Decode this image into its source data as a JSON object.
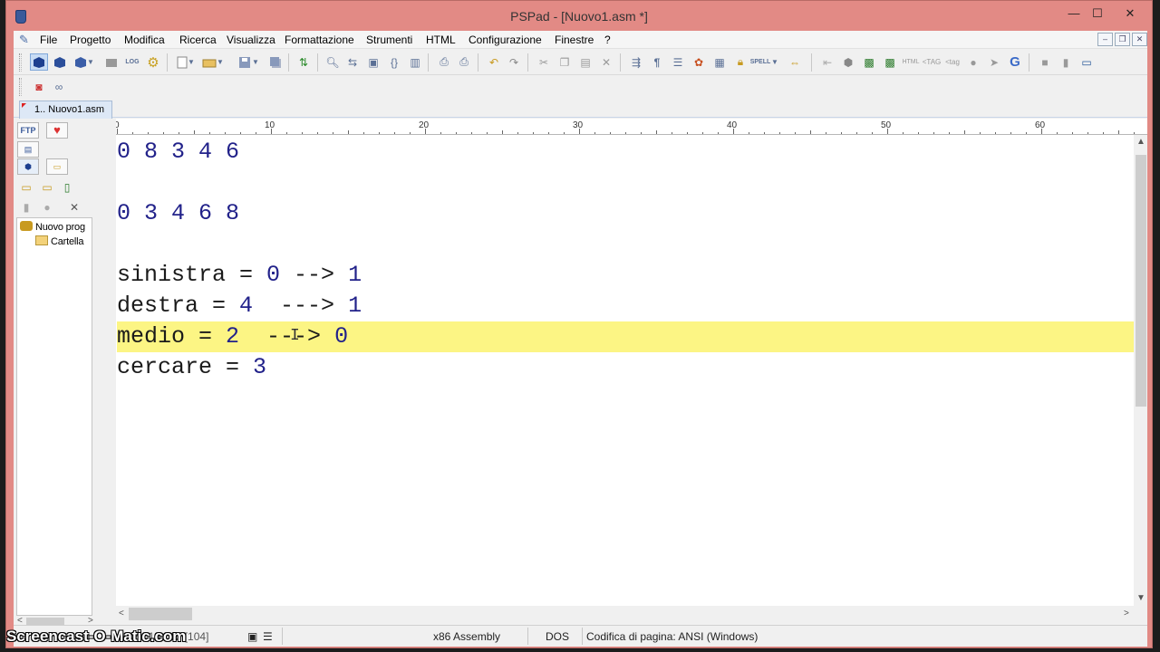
{
  "window": {
    "title": "PSPad - [Nuovo1.asm *]",
    "controls": {
      "minimize": "—",
      "maximize": "☐",
      "close": "✕"
    }
  },
  "menu": {
    "items": [
      "File",
      "Progetto",
      "Modifica",
      "Ricerca",
      "Visualizza",
      "Formattazione",
      "Strumenti",
      "HTML",
      "Configurazione",
      "Finestre",
      "?"
    ]
  },
  "tabs": [
    "1.. Nuovo1.asm"
  ],
  "side_panel": {
    "tab_ftp": "FTP",
    "tree": [
      {
        "label": "Nuovo prog"
      },
      {
        "label": "Cartella"
      }
    ]
  },
  "ruler": {
    "labels": [
      "0",
      "10",
      "20",
      "30",
      "40",
      "50",
      "60"
    ]
  },
  "editor": {
    "lines": [
      {
        "text": "0 8 3 4 6",
        "kind": "numbers"
      },
      {
        "text": "",
        "kind": "blank"
      },
      {
        "text": "0 3 4 6 8",
        "kind": "numbers"
      },
      {
        "text": "",
        "kind": "blank"
      },
      {
        "prefix": "sinistra = ",
        "value": "0",
        "arrow": " --> ",
        "result": "1",
        "kind": "assign"
      },
      {
        "prefix": "destra = ",
        "value": "4",
        "arrow": "  ---> ",
        "result": "1",
        "kind": "assign"
      },
      {
        "prefix": "medio = ",
        "value": "2",
        "arrow": "  ---> ",
        "result": "0",
        "kind": "assign",
        "current": true
      },
      {
        "prefix": "cercare = ",
        "value": "3",
        "arrow": "",
        "result": "",
        "kind": "assign"
      }
    ],
    "highlight_color": "#fcf584",
    "number_color": "#22228a"
  },
  "status": {
    "position": "7 : 18 / 12 [104]",
    "syntax": "x86 Assembly",
    "line_end": "DOS",
    "encoding": "Codifica di pagina: ANSI (Windows)"
  },
  "watermark": "Screencast-O-Matic.com"
}
